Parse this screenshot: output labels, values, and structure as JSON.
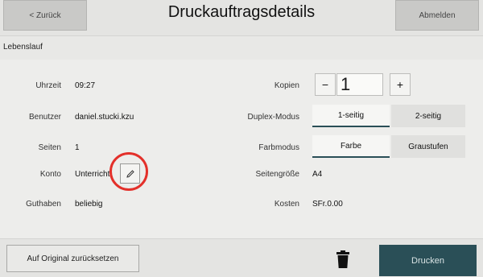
{
  "header": {
    "back_label": "< Zurück",
    "title": "Druckauftragsdetails",
    "logout_label": "Abmelden"
  },
  "document_name": "Lebenslauf",
  "details": {
    "time_label": "Uhrzeit",
    "time_value": "09:27",
    "user_label": "Benutzer",
    "user_value": "daniel.stucki.kzu",
    "pages_label": "Seiten",
    "pages_value": "1",
    "account_label": "Konto",
    "account_value": "Unterricht",
    "credit_label": "Guthaben",
    "credit_value": "beliebig"
  },
  "settings": {
    "copies_label": "Kopien",
    "copies_minus": "−",
    "copies_value": "1",
    "copies_plus": "+",
    "duplex_label": "Duplex-Modus",
    "duplex_options": [
      "1-seitig",
      "2-seitig"
    ],
    "duplex_selected": "1-seitig",
    "color_label": "Farbmodus",
    "color_options": [
      "Farbe",
      "Graustufen"
    ],
    "color_selected": "Farbe",
    "pagesize_label": "Seitengröße",
    "pagesize_value": "A4",
    "cost_label": "Kosten",
    "cost_value": "SFr.0.00"
  },
  "footer": {
    "reset_label": "Auf Original zurücksetzen",
    "print_label": "Drucken"
  },
  "colors": {
    "accent": "#2a4f57",
    "highlight_circle": "#e3302a"
  },
  "icons": {
    "edit": "pencil-icon",
    "delete": "trash-icon"
  }
}
